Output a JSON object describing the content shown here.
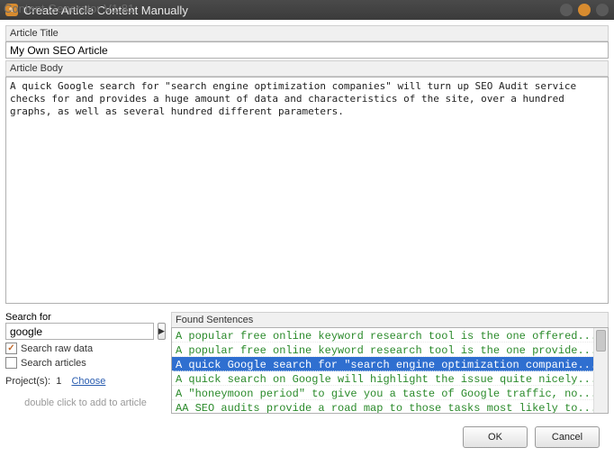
{
  "window": {
    "title": "Create Article Content Manually",
    "bg_title": "Content Generator V1.81"
  },
  "labels": {
    "article_title": "Article Title",
    "article_body": "Article Body",
    "search_for": "Search for",
    "search_raw": "Search raw data",
    "search_articles": "Search articles",
    "projects_prefix": "Project(s):",
    "projects_count": "1",
    "choose": "Choose",
    "hint": "double click to add to article",
    "found": "Found Sentences",
    "ok": "OK",
    "cancel": "Cancel"
  },
  "values": {
    "title": "My Own SEO Article",
    "body": "A quick Google search for \"search engine optimization companies\" will turn up SEO Audit service checks for and provides a huge amount of data and characteristics of the site, over a hundred graphs, as well as several hundred different parameters.",
    "search": "google",
    "raw_checked": true,
    "articles_checked": false
  },
  "found": {
    "selected_index": 2,
    "rows": [
      "A popular free online keyword research tool is the one offered...",
      "A popular free online keyword research tool is the one provide...",
      "A quick Google search for \"search engine optimization companie...",
      "A quick search on Google will highlight the issue quite nicely...",
      "A \"honeymoon period\" to give you a taste of Google traffic, no...",
      "AA SEO audits provide a road map to those tasks most likely to..."
    ]
  }
}
